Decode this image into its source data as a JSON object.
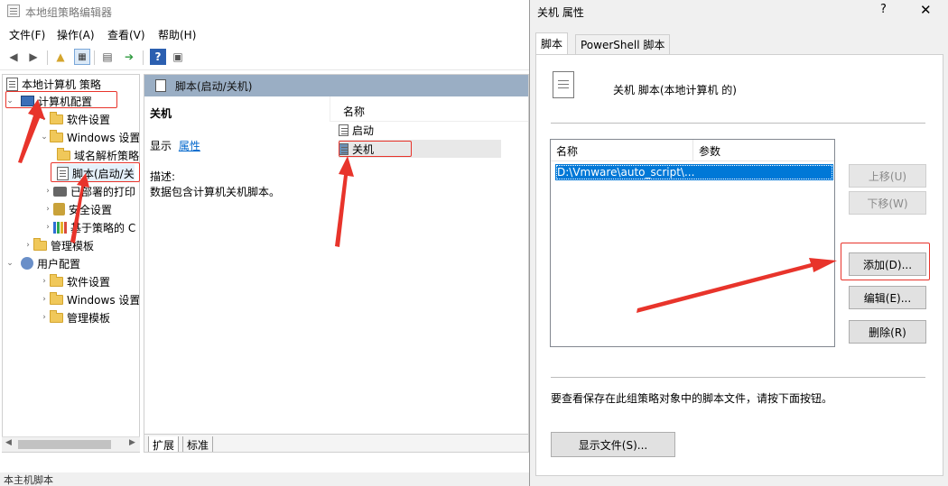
{
  "editor": {
    "title": "本地组策略编辑器",
    "menu": [
      "文件(F)",
      "操作(A)",
      "查看(V)",
      "帮助(H)"
    ],
    "tree": [
      {
        "label": "本地计算机 策略",
        "icon": "policy-icon",
        "caret": ""
      },
      {
        "label": "计算机配置",
        "icon": "computer-icon",
        "caret": "expanded"
      },
      {
        "label": "软件设置",
        "icon": "folder-icon",
        "caret": "collapsed"
      },
      {
        "label": "Windows 设置",
        "icon": "folder-icon",
        "caret": "expanded"
      },
      {
        "label": "域名解析策略",
        "icon": "folder-icon",
        "caret": ""
      },
      {
        "label": "脚本(启动/关",
        "icon": "script-icon",
        "caret": ""
      },
      {
        "label": "已部署的打印",
        "icon": "printer-icon",
        "caret": "collapsed"
      },
      {
        "label": "安全设置",
        "icon": "lock-icon",
        "caret": "collapsed"
      },
      {
        "label": "基于策略的 C",
        "icon": "chart-icon",
        "caret": "collapsed"
      },
      {
        "label": "管理模板",
        "icon": "folder-icon",
        "caret": "collapsed"
      },
      {
        "label": "用户配置",
        "icon": "user-icon",
        "caret": "expanded"
      },
      {
        "label": "软件设置",
        "icon": "folder-icon",
        "caret": "collapsed"
      },
      {
        "label": "Windows 设置",
        "icon": "folder-icon",
        "caret": "collapsed"
      },
      {
        "label": "管理模板",
        "icon": "folder-icon",
        "caret": "collapsed"
      }
    ],
    "detail_header": "脚本(启动/关机)",
    "detail": {
      "heading": "关机",
      "show_prefix": "显示",
      "properties_link": "属性",
      "desc_label": "描述:",
      "desc_text": "数据包含计算机关机脚本。"
    },
    "list_column": "名称",
    "list_items": [
      "启动",
      "关机"
    ],
    "bottom_tabs": [
      "扩展",
      "标准"
    ],
    "status": "本主机脚本"
  },
  "dialog": {
    "title": "关机 属性",
    "help": "?",
    "close": "✕",
    "tabs": [
      "脚本",
      "PowerShell 脚本"
    ],
    "header": "关机 脚本(本地计算机 的)",
    "columns": [
      "名称",
      "参数"
    ],
    "scripts": [
      {
        "name": "D:\\Vmware\\auto_script\\...",
        "params": ""
      }
    ],
    "buttons": {
      "up": "上移(U)",
      "down": "下移(W)",
      "add": "添加(D)...",
      "edit": "编辑(E)...",
      "remove": "删除(R)"
    },
    "footer_text": "要查看保存在此组策略对象中的脚本文件，请按下面按钮。",
    "show_files": "显示文件(S)..."
  },
  "colors": {
    "annotation": "#e8342b",
    "selection": "#0078d7",
    "detail_header": "#9aaec4"
  }
}
